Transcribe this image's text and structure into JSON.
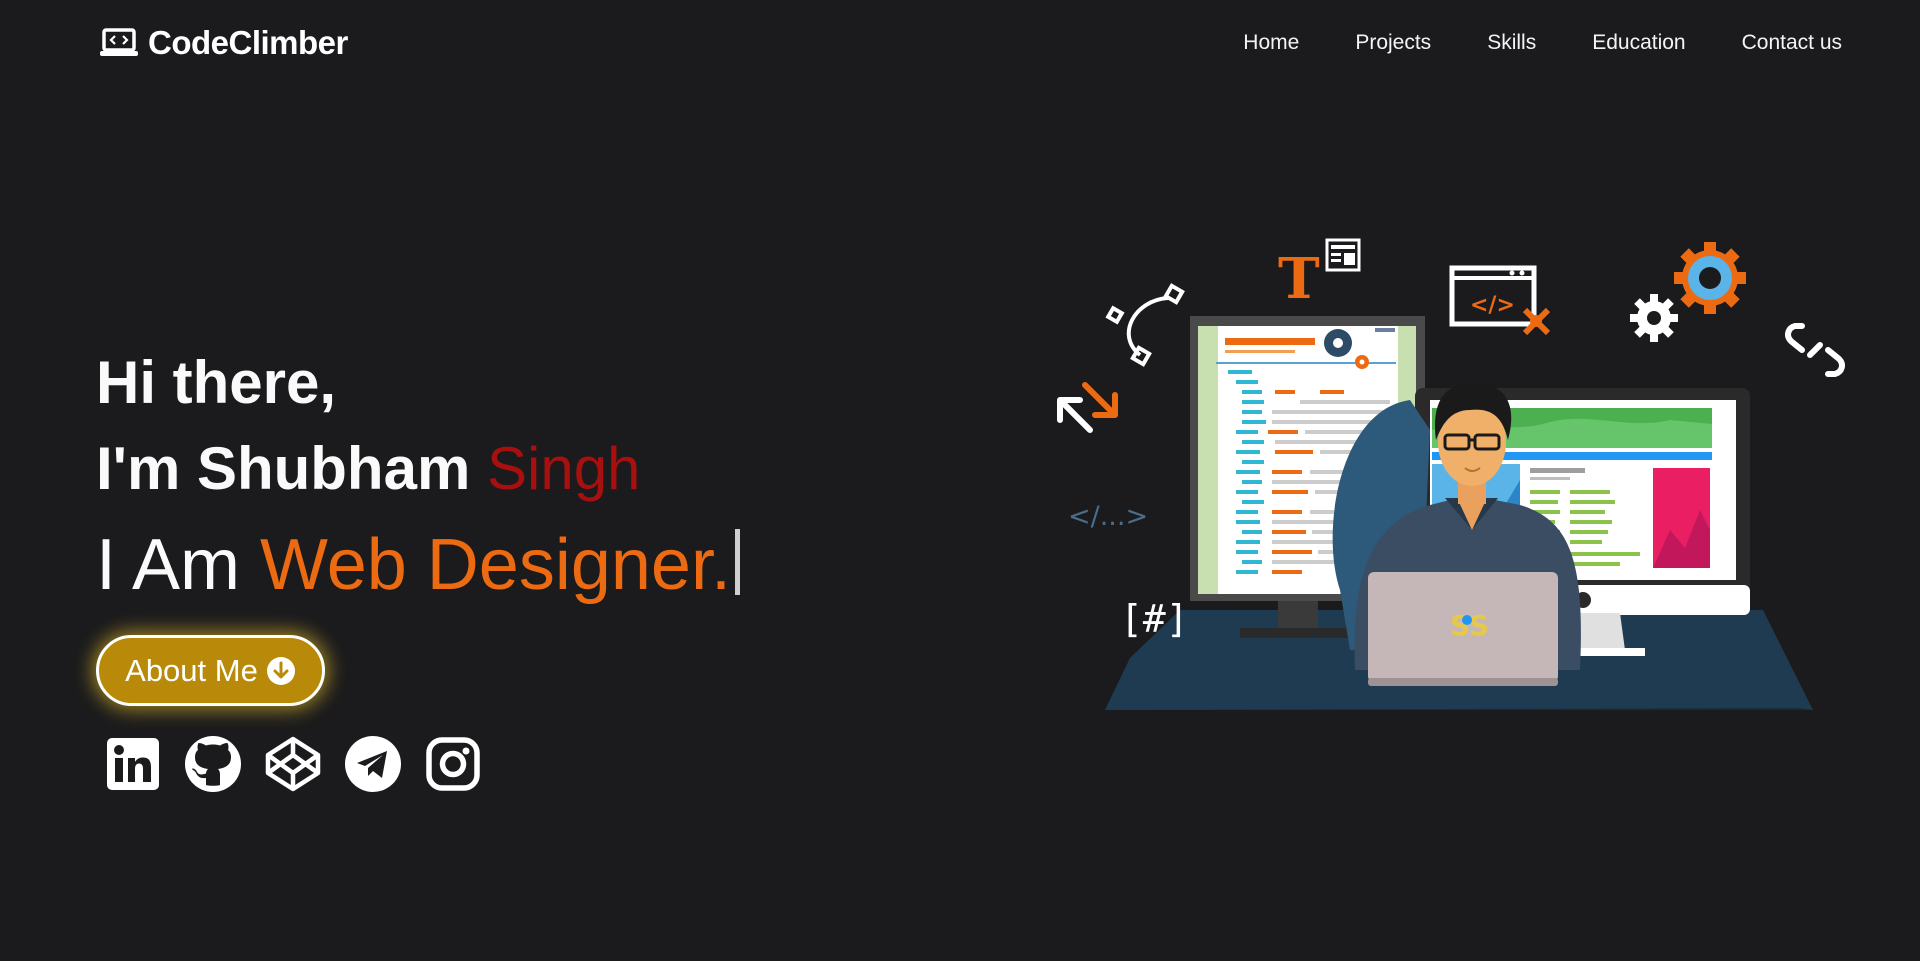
{
  "brand": {
    "name": "CodeClimber",
    "icon": "laptop-code-icon"
  },
  "nav": {
    "items": [
      {
        "label": "Home"
      },
      {
        "label": "Projects"
      },
      {
        "label": "Skills"
      },
      {
        "label": "Education"
      },
      {
        "label": "Contact us"
      }
    ]
  },
  "hero": {
    "greeting": "Hi there,",
    "intro_prefix": "I'm Shubham ",
    "intro_accent": "Singh",
    "role_prefix": "I Am ",
    "role_word": "Web Designer."
  },
  "about_button": {
    "label": "About Me",
    "icon": "arrow-down-circle-icon"
  },
  "socials": [
    {
      "name": "linkedin-icon"
    },
    {
      "name": "github-icon"
    },
    {
      "name": "codepen-icon"
    },
    {
      "name": "telegram-icon"
    },
    {
      "name": "instagram-icon"
    }
  ],
  "illustration": {
    "code_tag": "</...>",
    "hash_tag": "[#]",
    "type_letter": "T",
    "code_icon_text": "</>",
    "laptop_logo": "SS"
  },
  "colors": {
    "background": "#1b1b1d",
    "accent_red": "#a80f0f",
    "accent_orange": "#ec6b12",
    "button_gold": "#b98a0a"
  }
}
